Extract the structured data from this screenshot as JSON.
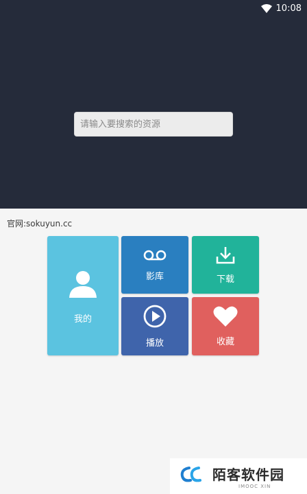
{
  "status_bar": {
    "time": "10:08",
    "wifi_icon": "wifi-icon"
  },
  "search": {
    "placeholder": "请输入要搜索的资源"
  },
  "official_site": "官网:sokuyun.cc",
  "tiles": {
    "me": {
      "label": "我的",
      "icon": "person-icon",
      "color": "#5bc3e0"
    },
    "library": {
      "label": "影库",
      "icon": "voicemail-icon",
      "color": "#2a7fc0"
    },
    "download": {
      "label": "下载",
      "icon": "download-icon",
      "color": "#21b39a"
    },
    "play": {
      "label": "播放",
      "icon": "play-circle-icon",
      "color": "#3f64ab"
    },
    "favorites": {
      "label": "收藏",
      "icon": "heart-icon",
      "color": "#e0605e"
    }
  },
  "watermark": {
    "title": "陌客软件园",
    "subtitle": "IMOOC XIN"
  },
  "colors": {
    "hero_background": "#252b3a",
    "page_background": "#f5f5f5"
  }
}
